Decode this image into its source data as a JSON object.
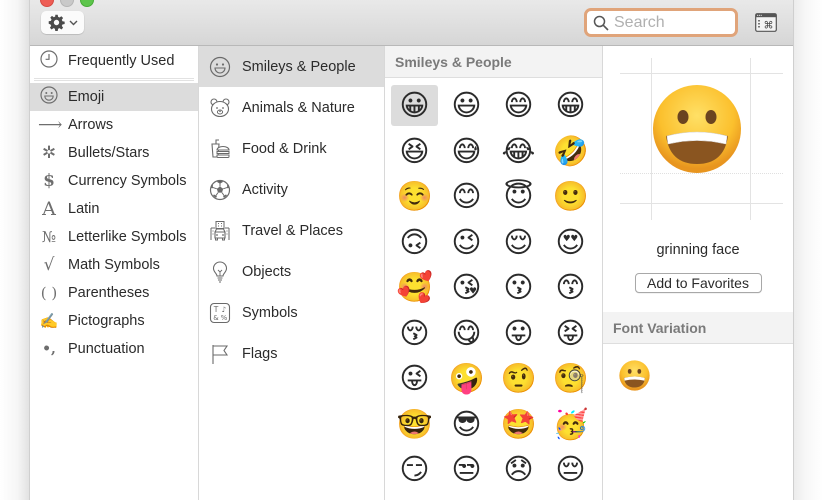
{
  "toolbar": {
    "gear_icon": "gear-icon",
    "gear_glyph": "✱",
    "chevron_glyph": "⌄",
    "search_placeholder": "Search",
    "search_value": "",
    "accent_color": "#e0a47a"
  },
  "categories": [
    {
      "label": "Frequently Used",
      "icon": "clock-icon",
      "glyph": "◷",
      "selected": false
    },
    {
      "label": "Emoji",
      "icon": "smiley-icon",
      "glyph": "☺",
      "selected": true
    },
    {
      "label": "Arrows",
      "icon": "arrow-icon",
      "glyph": "⟶",
      "selected": false
    },
    {
      "label": "Bullets/Stars",
      "icon": "asterisk-icon",
      "glyph": "✲",
      "selected": false
    },
    {
      "label": "Currency Symbols",
      "icon": "dollar-icon",
      "glyph": "$",
      "selected": false
    },
    {
      "label": "Latin",
      "icon": "latin-a-icon",
      "glyph": "A",
      "selected": false
    },
    {
      "label": "Letterlike Symbols",
      "icon": "numero-icon",
      "glyph": "№",
      "selected": false
    },
    {
      "label": "Math Symbols",
      "icon": "square-root-icon",
      "glyph": "√",
      "selected": false
    },
    {
      "label": "Parentheses",
      "icon": "parentheses-icon",
      "glyph": "( )",
      "selected": false
    },
    {
      "label": "Pictographs",
      "icon": "pictograph-icon",
      "glyph": "✍",
      "selected": false
    },
    {
      "label": "Punctuation",
      "icon": "punctuation-icon",
      "glyph": "•,",
      "selected": false
    }
  ],
  "subcategories": [
    {
      "label": "Smileys & People",
      "icon": "smiley-icon",
      "selected": true
    },
    {
      "label": "Animals & Nature",
      "icon": "bear-icon",
      "selected": false
    },
    {
      "label": "Food & Drink",
      "icon": "food-icon",
      "selected": false
    },
    {
      "label": "Activity",
      "icon": "soccer-ball-icon",
      "selected": false
    },
    {
      "label": "Travel & Places",
      "icon": "car-icon",
      "selected": false
    },
    {
      "label": "Objects",
      "icon": "lightbulb-icon",
      "selected": false
    },
    {
      "label": "Symbols",
      "icon": "symbols-icon",
      "selected": false
    },
    {
      "label": "Flags",
      "icon": "flag-icon",
      "selected": false
    }
  ],
  "emoji_section": {
    "title": "Smileys & People",
    "selected_index": 0,
    "items": [
      {
        "char": "😀",
        "name": "grinning face"
      },
      {
        "char": "😃",
        "name": "grinning face with big eyes"
      },
      {
        "char": "😄",
        "name": "grinning face with smiling eyes"
      },
      {
        "char": "😁",
        "name": "beaming face with smiling eyes"
      },
      {
        "char": "😆",
        "name": "grinning squinting face"
      },
      {
        "char": "😅",
        "name": "grinning face with sweat"
      },
      {
        "char": "😂",
        "name": "face with tears of joy"
      },
      {
        "char": "🤣",
        "name": "rolling on the floor laughing"
      },
      {
        "char": "☺️",
        "name": "smiling face"
      },
      {
        "char": "😊",
        "name": "smiling face with smiling eyes"
      },
      {
        "char": "😇",
        "name": "smiling face with halo"
      },
      {
        "char": "🙂",
        "name": "slightly smiling face"
      },
      {
        "char": "🙃",
        "name": "upside-down face"
      },
      {
        "char": "😉",
        "name": "winking face"
      },
      {
        "char": "😌",
        "name": "relieved face"
      },
      {
        "char": "😍",
        "name": "smiling face with heart-eyes"
      },
      {
        "char": "🥰",
        "name": "smiling face with hearts"
      },
      {
        "char": "😘",
        "name": "face blowing a kiss"
      },
      {
        "char": "😗",
        "name": "kissing face"
      },
      {
        "char": "😙",
        "name": "kissing face with smiling eyes"
      },
      {
        "char": "😚",
        "name": "kissing face with closed eyes"
      },
      {
        "char": "😋",
        "name": "face savoring food"
      },
      {
        "char": "😛",
        "name": "face with tongue"
      },
      {
        "char": "😝",
        "name": "squinting face with tongue"
      },
      {
        "char": "😜",
        "name": "winking face with tongue"
      },
      {
        "char": "🤪",
        "name": "zany face"
      },
      {
        "char": "🤨",
        "name": "face with raised eyebrow"
      },
      {
        "char": "🧐",
        "name": "face with monocle"
      },
      {
        "char": "🤓",
        "name": "nerd face"
      },
      {
        "char": "😎",
        "name": "smiling face with sunglasses"
      },
      {
        "char": "🤩",
        "name": "star-struck"
      },
      {
        "char": "🥳",
        "name": "partying face"
      },
      {
        "char": "😏",
        "name": "smirking face"
      },
      {
        "char": "😒",
        "name": "unamused face"
      },
      {
        "char": "😞",
        "name": "disappointed face"
      },
      {
        "char": "😔",
        "name": "pensive face"
      }
    ]
  },
  "detail": {
    "char": "😀",
    "name": "grinning face",
    "add_favorites_label": "Add to Favorites",
    "font_variation_title": "Font Variation",
    "font_variations": [
      "😀"
    ]
  }
}
